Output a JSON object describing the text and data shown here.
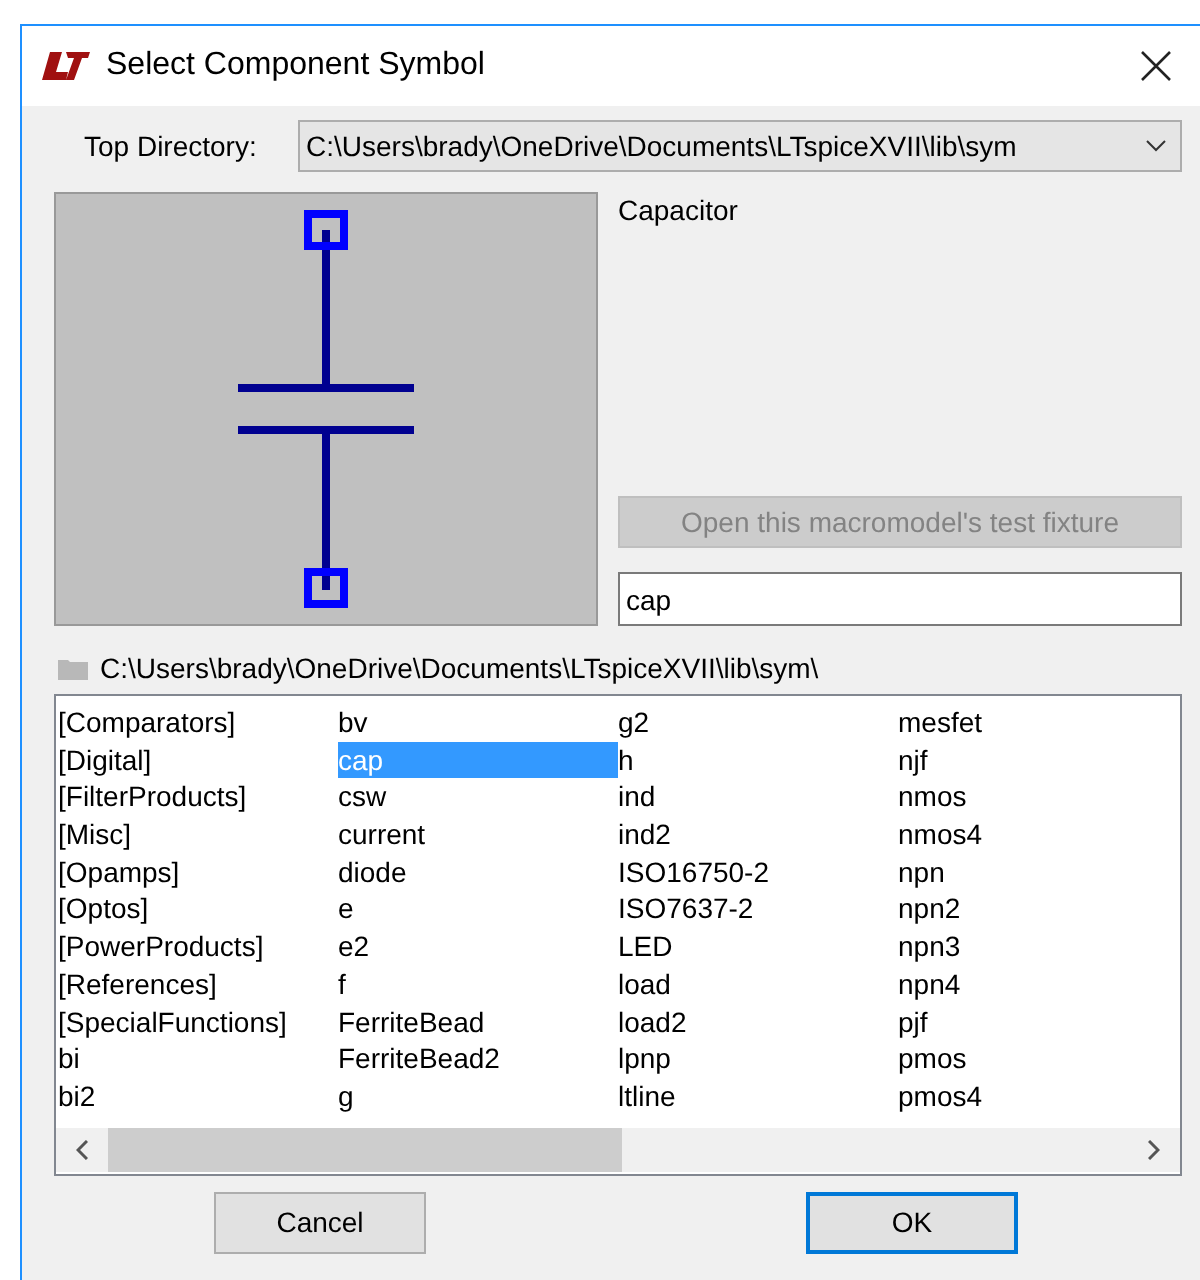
{
  "window": {
    "title": "Select Component Symbol"
  },
  "top_directory": {
    "label": "Top Directory:",
    "value": "C:\\Users\\brady\\OneDrive\\Documents\\LTspiceXVII\\lib\\sym"
  },
  "description": "Capacitor",
  "test_fixture_button": {
    "label": "Open this macromodel's test fixture",
    "disabled": true
  },
  "name_field": {
    "value": "cap"
  },
  "path": "C:\\Users\\brady\\OneDrive\\Documents\\LTspiceXVII\\lib\\sym\\",
  "list": {
    "items": [
      {
        "label": "[Comparators]",
        "selected": false
      },
      {
        "label": "[Digital]",
        "selected": false
      },
      {
        "label": "[FilterProducts]",
        "selected": false
      },
      {
        "label": "[Misc]",
        "selected": false
      },
      {
        "label": "[Opamps]",
        "selected": false
      },
      {
        "label": "[Optos]",
        "selected": false
      },
      {
        "label": "[PowerProducts]",
        "selected": false
      },
      {
        "label": "[References]",
        "selected": false
      },
      {
        "label": "[SpecialFunctions]",
        "selected": false
      },
      {
        "label": "bi",
        "selected": false
      },
      {
        "label": "bi2",
        "selected": false
      },
      {
        "label": "bv",
        "selected": false
      },
      {
        "label": "cap",
        "selected": true
      },
      {
        "label": "csw",
        "selected": false
      },
      {
        "label": "current",
        "selected": false
      },
      {
        "label": "diode",
        "selected": false
      },
      {
        "label": "e",
        "selected": false
      },
      {
        "label": "e2",
        "selected": false
      },
      {
        "label": "f",
        "selected": false
      },
      {
        "label": "FerriteBead",
        "selected": false
      },
      {
        "label": "FerriteBead2",
        "selected": false
      },
      {
        "label": "g",
        "selected": false
      },
      {
        "label": "g2",
        "selected": false
      },
      {
        "label": "h",
        "selected": false
      },
      {
        "label": "ind",
        "selected": false
      },
      {
        "label": "ind2",
        "selected": false
      },
      {
        "label": "ISO16750-2",
        "selected": false
      },
      {
        "label": "ISO7637-2",
        "selected": false
      },
      {
        "label": "LED",
        "selected": false
      },
      {
        "label": "load",
        "selected": false
      },
      {
        "label": "load2",
        "selected": false
      },
      {
        "label": "lpnp",
        "selected": false
      },
      {
        "label": "ltline",
        "selected": false
      },
      {
        "label": "mesfet",
        "selected": false
      },
      {
        "label": "njf",
        "selected": false
      },
      {
        "label": "nmos",
        "selected": false
      },
      {
        "label": "nmos4",
        "selected": false
      },
      {
        "label": "npn",
        "selected": false
      },
      {
        "label": "npn2",
        "selected": false
      },
      {
        "label": "npn3",
        "selected": false
      },
      {
        "label": "npn4",
        "selected": false
      },
      {
        "label": "pjf",
        "selected": false
      },
      {
        "label": "pmos",
        "selected": false
      },
      {
        "label": "pmos4",
        "selected": false
      }
    ]
  },
  "buttons": [
    {
      "label": "Cancel",
      "default": false
    },
    {
      "label": "OK",
      "default": true
    }
  ]
}
